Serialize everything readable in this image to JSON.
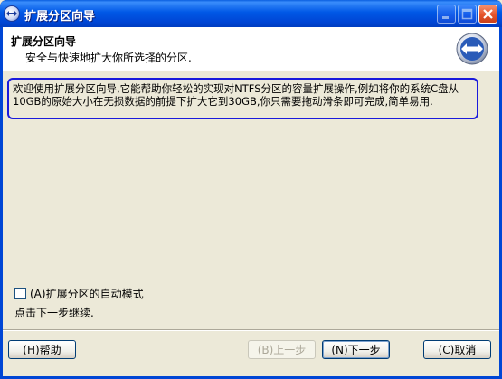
{
  "window": {
    "title": "扩展分区向导",
    "icon": "partition-app-icon"
  },
  "header": {
    "title": "扩展分区向导",
    "subtitle": "安全与快速地扩大你所选择的分区.",
    "icon": "wizard-arrows-icon"
  },
  "description": "欢迎使用扩展分区向导,它能帮助你轻松的实现对NTFS分区的容量扩展操作,例如将你的系统C盘从10GB的原始大小在无损数据的前提下扩大它到30GB,你只需要拖动滑条即可完成,简单易用.",
  "auto_mode": {
    "label": "(A)扩展分区的自动模式",
    "checked": false
  },
  "hint": "点击下一步继续.",
  "buttons": {
    "help": "(H)帮助",
    "back": "(B)上一步",
    "next": "(N)下一步",
    "cancel": "(C)取消"
  },
  "colors": {
    "titlebar": "#0058e6",
    "highlight_border": "#1a1adc",
    "face": "#ece9d8"
  }
}
